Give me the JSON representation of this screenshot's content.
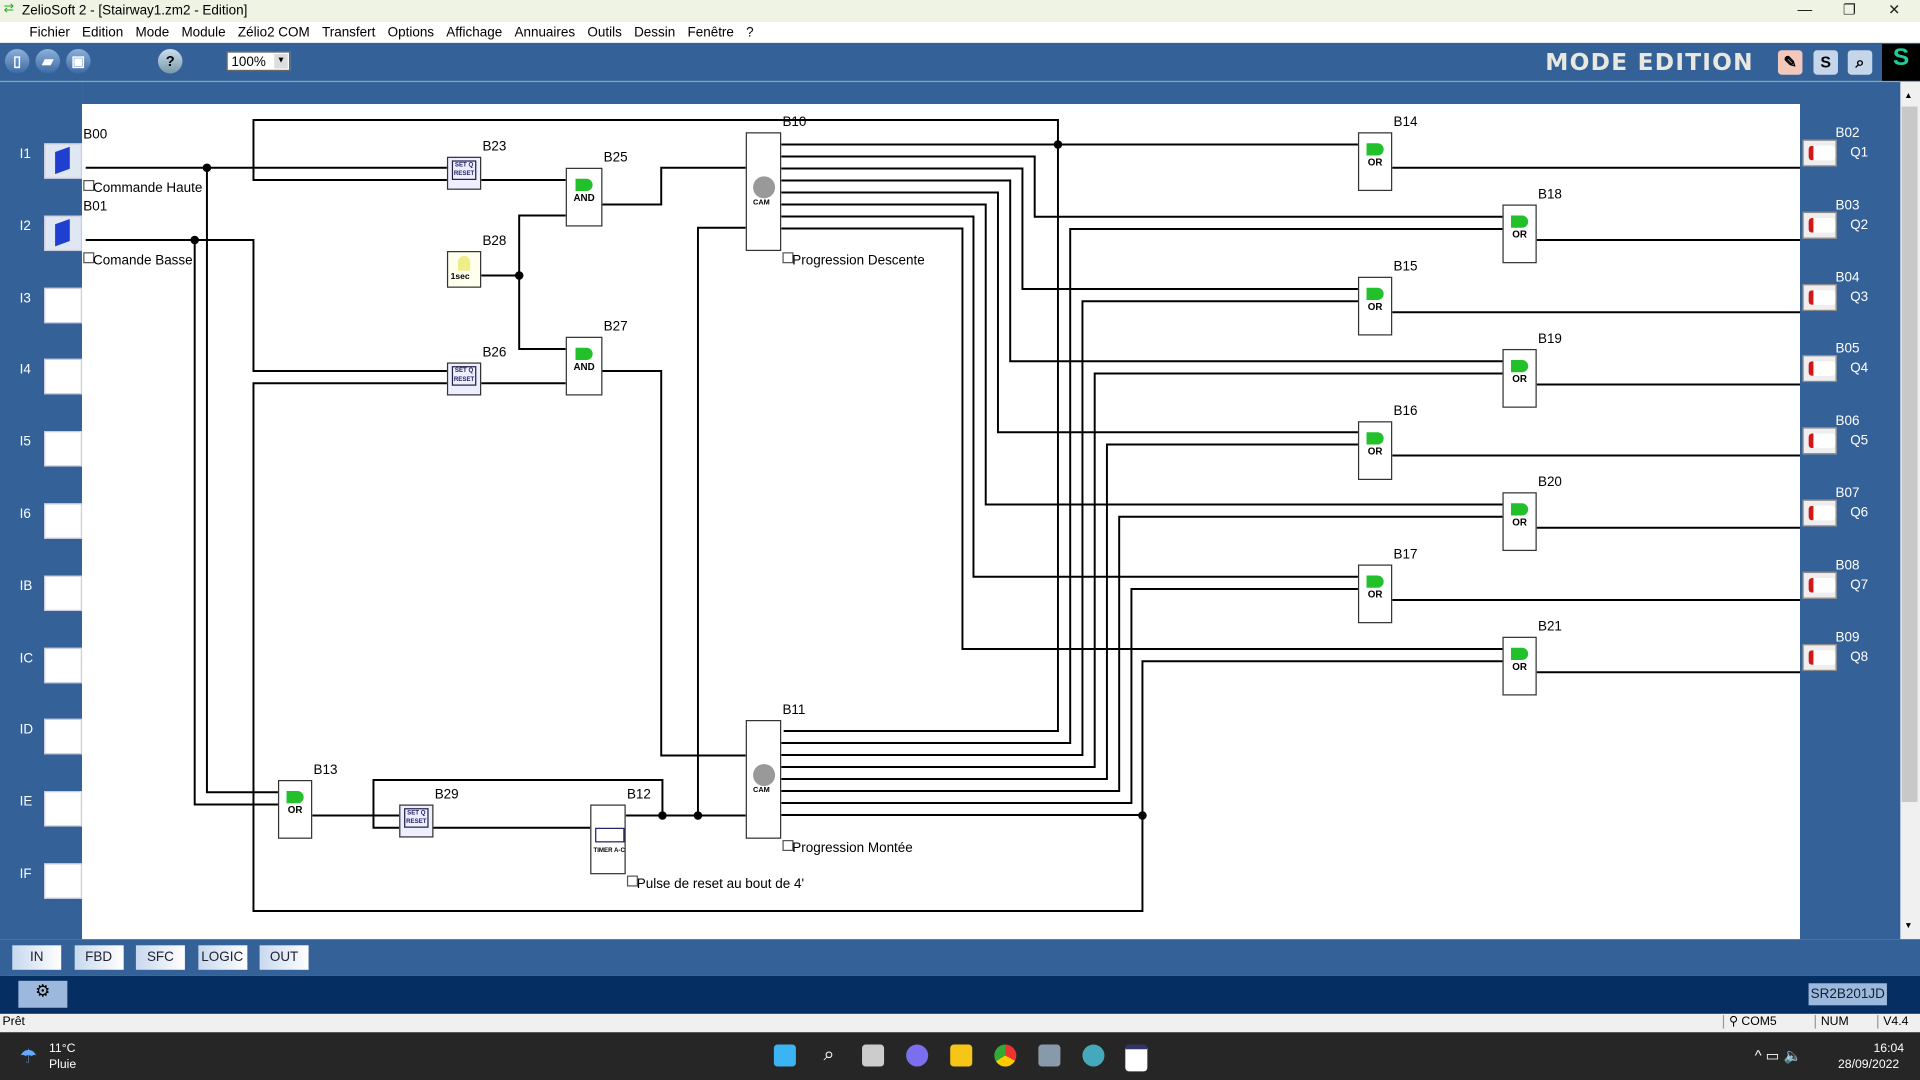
{
  "window": {
    "title": "ZelioSoft 2 - [Stairway1.zm2 - Edition]"
  },
  "menu": [
    "Fichier",
    "Edition",
    "Mode",
    "Module",
    "Zélio2 COM",
    "Transfert",
    "Options",
    "Affichage",
    "Annuaires",
    "Outils",
    "Dessin",
    "Fenêtre",
    "?"
  ],
  "toolbar": {
    "zoom": "100%",
    "mode": "MODE EDITION",
    "help": "?",
    "s_button": "S"
  },
  "inputs": [
    "I1",
    "I2",
    "I3",
    "I4",
    "I5",
    "I6",
    "IB",
    "IC",
    "ID",
    "IE",
    "IF"
  ],
  "outputs": [
    "Q1",
    "Q2",
    "Q3",
    "Q4",
    "Q5",
    "Q6",
    "Q7",
    "Q8"
  ],
  "output_blocks": [
    "B02",
    "B03",
    "B04",
    "B05",
    "B06",
    "B07",
    "B08",
    "B09"
  ],
  "diagram": {
    "input_blocks": [
      {
        "id": "B00",
        "comment": "Commande Haute"
      },
      {
        "id": "B01",
        "comment": "Comande Basse"
      }
    ],
    "blocks": {
      "B23": {
        "id": "B23",
        "type": "SET/RESET"
      },
      "B26": {
        "id": "B26",
        "type": "SET/RESET"
      },
      "B29": {
        "id": "B29",
        "type": "SET/RESET"
      },
      "B28": {
        "id": "B28",
        "type": "1sec"
      },
      "B25": {
        "id": "B25",
        "type": "AND"
      },
      "B27": {
        "id": "B27",
        "type": "AND"
      },
      "B10": {
        "id": "B10",
        "type": "CAM",
        "comment": "Progression Descente"
      },
      "B11": {
        "id": "B11",
        "type": "CAM",
        "comment": "Progression Montée"
      },
      "B12": {
        "id": "B12",
        "type": "TIMER A-C",
        "comment": "Pulse de reset au bout de 4'"
      },
      "B13": {
        "id": "B13",
        "type": "OR"
      },
      "B14": {
        "id": "B14",
        "type": "OR"
      },
      "B15": {
        "id": "B15",
        "type": "OR"
      },
      "B16": {
        "id": "B16",
        "type": "OR"
      },
      "B17": {
        "id": "B17",
        "type": "OR"
      },
      "B18": {
        "id": "B18",
        "type": "OR"
      },
      "B19": {
        "id": "B19",
        "type": "OR"
      },
      "B20": {
        "id": "B20",
        "type": "OR"
      },
      "B21": {
        "id": "B21",
        "type": "OR"
      }
    }
  },
  "tabs": [
    "IN",
    "FBD",
    "SFC",
    "LOGIC",
    "OUT"
  ],
  "module_ref": "SR2B201JD",
  "status": {
    "text": "Prêt",
    "port": "COM5",
    "num": "NUM",
    "version": "V4.4"
  },
  "taskbar": {
    "temp": "11°C",
    "weather": "Pluie",
    "time": "16:04",
    "date": "28/09/2022"
  }
}
